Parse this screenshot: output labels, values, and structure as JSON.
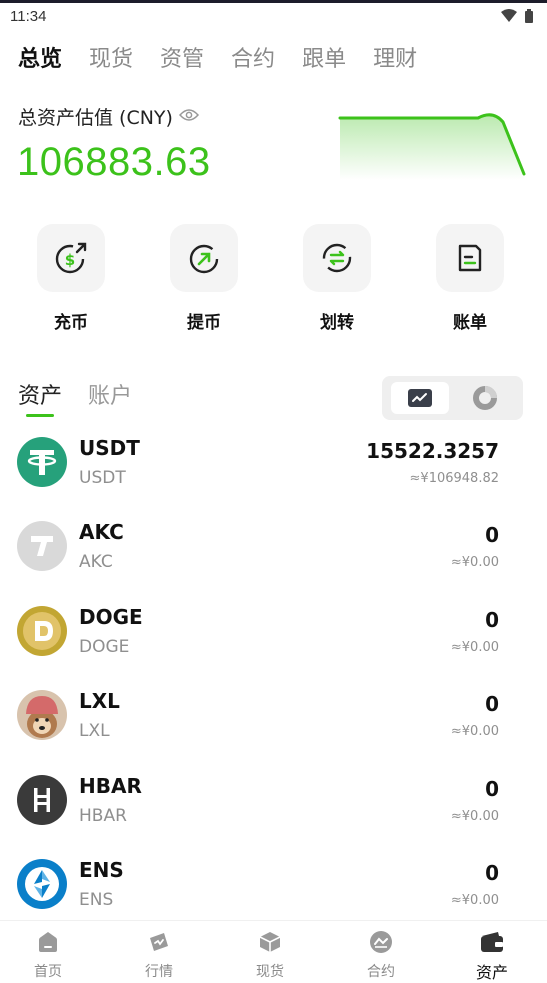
{
  "status": {
    "time": "11:34"
  },
  "top_tabs": [
    "总览",
    "现货",
    "资管",
    "合约",
    "跟单",
    "理财"
  ],
  "asset_summary": {
    "label": "总资产估值 (CNY)",
    "value": "106883.63",
    "accent": "#3cc21b"
  },
  "quick_actions": [
    {
      "label": "充币",
      "icon": "deposit-icon"
    },
    {
      "label": "提币",
      "icon": "withdraw-icon"
    },
    {
      "label": "划转",
      "icon": "transfer-icon"
    },
    {
      "label": "账单",
      "icon": "bill-icon"
    }
  ],
  "sub_tabs": [
    "资产",
    "账户"
  ],
  "assets": [
    {
      "name": "USDT",
      "sub": "USDT",
      "amount": "15522.3257",
      "fiat": "≈¥106948.82",
      "icon": "usdt-icon",
      "color": "#26a17b"
    },
    {
      "name": "AKC",
      "sub": "AKC",
      "amount": "0",
      "fiat": "≈¥0.00",
      "icon": "akc-icon",
      "color": "#d9d9d9"
    },
    {
      "name": "DOGE",
      "sub": "DOGE",
      "amount": "0",
      "fiat": "≈¥0.00",
      "icon": "doge-icon",
      "color": "#c2a633"
    },
    {
      "name": "LXL",
      "sub": "LXL",
      "amount": "0",
      "fiat": "≈¥0.00",
      "icon": "lxl-icon",
      "color": "#c98a6a"
    },
    {
      "name": "HBAR",
      "sub": "HBAR",
      "amount": "0",
      "fiat": "≈¥0.00",
      "icon": "hbar-icon",
      "color": "#3a3a3a"
    },
    {
      "name": "ENS",
      "sub": "ENS",
      "amount": "0",
      "fiat": "≈¥0.00",
      "icon": "ens-icon",
      "color": "#0a7fc9"
    }
  ],
  "bottom_nav": [
    {
      "label": "首页",
      "icon": "home-icon"
    },
    {
      "label": "行情",
      "icon": "market-icon"
    },
    {
      "label": "现货",
      "icon": "spot-icon"
    },
    {
      "label": "合约",
      "icon": "contract-icon"
    },
    {
      "label": "资产",
      "icon": "wallet-icon"
    }
  ]
}
